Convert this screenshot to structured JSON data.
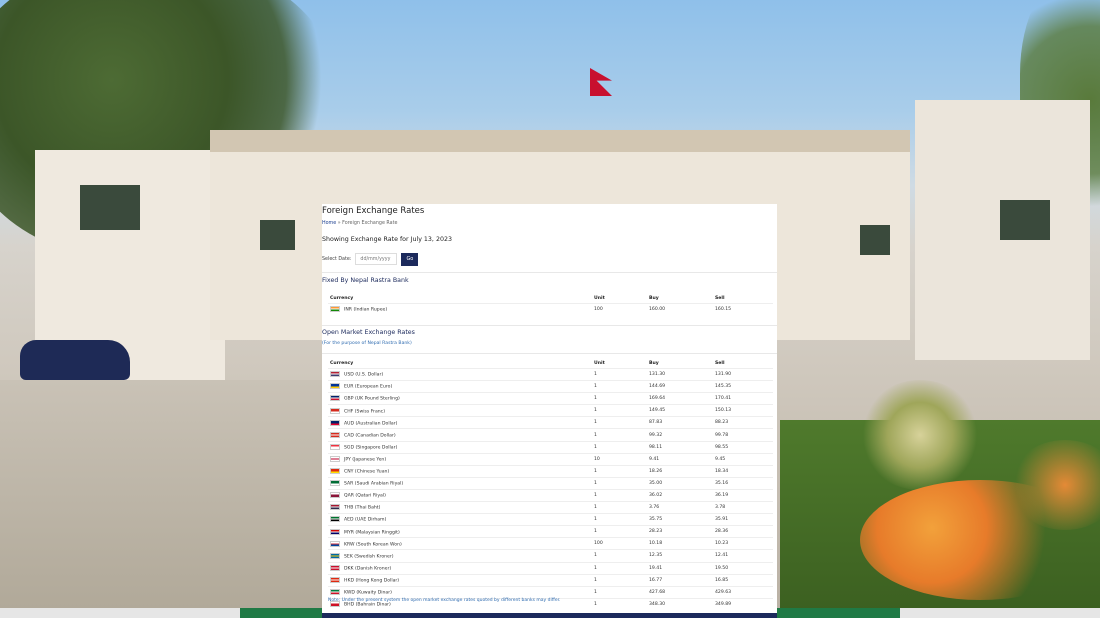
{
  "page": {
    "title": "Foreign Exchange Rates",
    "breadcrumb": {
      "home": "Home",
      "separator": "»",
      "current": "Foreign Exchange Rate"
    },
    "showing": "Showing Exchange Rate for July 13, 2023",
    "date_filter": {
      "label": "Select Date:",
      "placeholder": "dd/mm/yyyy",
      "button": "Go"
    }
  },
  "fixed": {
    "title": "Fixed By Nepal Rastra Bank",
    "headers": {
      "currency": "Currency",
      "unit": "Unit",
      "buy": "Buy",
      "sell": "Sell"
    },
    "rows": [
      {
        "currency": "INR (Indian Rupee)",
        "unit": "100",
        "buy": "160.00",
        "sell": "160.15",
        "flag": "in",
        "flag_colors": [
          "#ff9933",
          "#ffffff",
          "#138808"
        ]
      }
    ]
  },
  "open_market": {
    "title": "Open Market Exchange Rates",
    "subtitle": "(For the purpose of Nepal Rastra Bank)",
    "headers": {
      "currency": "Currency",
      "unit": "Unit",
      "buy": "Buy",
      "sell": "Sell"
    },
    "rows": [
      {
        "currency": "USD (U.S. Dollar)",
        "unit": "1",
        "buy": "131.30",
        "sell": "131.90",
        "flag": "us",
        "flag_colors": [
          "#b22234",
          "#ffffff",
          "#3c3b6e"
        ]
      },
      {
        "currency": "EUR (European Euro)",
        "unit": "1",
        "buy": "144.69",
        "sell": "145.35",
        "flag": "eu",
        "flag_colors": [
          "#003399",
          "#003399",
          "#ffcc00"
        ]
      },
      {
        "currency": "GBP (UK Pound Sterling)",
        "unit": "1",
        "buy": "169.64",
        "sell": "170.41",
        "flag": "gb",
        "flag_colors": [
          "#012169",
          "#ffffff",
          "#c8102e"
        ]
      },
      {
        "currency": "CHF (Swiss Franc)",
        "unit": "1",
        "buy": "149.45",
        "sell": "150.13",
        "flag": "ch",
        "flag_colors": [
          "#d52b1e",
          "#d52b1e",
          "#ffffff"
        ]
      },
      {
        "currency": "AUD (Australian Dollar)",
        "unit": "1",
        "buy": "87.83",
        "sell": "88.23",
        "flag": "au",
        "flag_colors": [
          "#012169",
          "#012169",
          "#e4002b"
        ]
      },
      {
        "currency": "CAD (Canadian Dollar)",
        "unit": "1",
        "buy": "99.32",
        "sell": "99.78",
        "flag": "ca",
        "flag_colors": [
          "#d52b1e",
          "#ffffff",
          "#d52b1e"
        ]
      },
      {
        "currency": "SGD (Singapore Dollar)",
        "unit": "1",
        "buy": "98.11",
        "sell": "98.55",
        "flag": "sg",
        "flag_colors": [
          "#ef3340",
          "#ffffff",
          "#ffffff"
        ]
      },
      {
        "currency": "JPY (Japanese Yen)",
        "unit": "10",
        "buy": "9.41",
        "sell": "9.45",
        "flag": "jp",
        "flag_colors": [
          "#ffffff",
          "#bc002d",
          "#ffffff"
        ]
      },
      {
        "currency": "CNY (Chinese Yuan)",
        "unit": "1",
        "buy": "18.26",
        "sell": "18.34",
        "flag": "cn",
        "flag_colors": [
          "#de2910",
          "#de2910",
          "#ffde00"
        ]
      },
      {
        "currency": "SAR (Saudi Arabian Riyal)",
        "unit": "1",
        "buy": "35.00",
        "sell": "35.16",
        "flag": "sa",
        "flag_colors": [
          "#006c35",
          "#006c35",
          "#ffffff"
        ]
      },
      {
        "currency": "QAR (Qatari Riyal)",
        "unit": "1",
        "buy": "36.02",
        "sell": "36.19",
        "flag": "qa",
        "flag_colors": [
          "#ffffff",
          "#8a1538",
          "#8a1538"
        ]
      },
      {
        "currency": "THB (Thai Baht)",
        "unit": "1",
        "buy": "3.76",
        "sell": "3.78",
        "flag": "th",
        "flag_colors": [
          "#a51931",
          "#f4f5f8",
          "#2d2a4a"
        ]
      },
      {
        "currency": "AED (UAE Dirham)",
        "unit": "1",
        "buy": "35.75",
        "sell": "35.91",
        "flag": "ae",
        "flag_colors": [
          "#00732f",
          "#ffffff",
          "#000000"
        ]
      },
      {
        "currency": "MYR (Malaysian Ringgit)",
        "unit": "1",
        "buy": "28.23",
        "sell": "28.36",
        "flag": "my",
        "flag_colors": [
          "#cc0001",
          "#ffffff",
          "#010066"
        ]
      },
      {
        "currency": "KRW (South Korean Won)",
        "unit": "100",
        "buy": "10.18",
        "sell": "10.23",
        "flag": "kr",
        "flag_colors": [
          "#ffffff",
          "#cd2e3a",
          "#0047a0"
        ]
      },
      {
        "currency": "SEK (Swedish Kroner)",
        "unit": "1",
        "buy": "12.35",
        "sell": "12.41",
        "flag": "se",
        "flag_colors": [
          "#006aa7",
          "#fecc00",
          "#006aa7"
        ]
      },
      {
        "currency": "DKK (Danish Kroner)",
        "unit": "1",
        "buy": "19.41",
        "sell": "19.50",
        "flag": "dk",
        "flag_colors": [
          "#c8102e",
          "#ffffff",
          "#c8102e"
        ]
      },
      {
        "currency": "HKD (Hong Kong Dollar)",
        "unit": "1",
        "buy": "16.77",
        "sell": "16.85",
        "flag": "hk",
        "flag_colors": [
          "#de2910",
          "#ffffff",
          "#de2910"
        ]
      },
      {
        "currency": "KWD (Kuwaity Dinar)",
        "unit": "1",
        "buy": "427.68",
        "sell": "429.63",
        "flag": "kw",
        "flag_colors": [
          "#007a3d",
          "#ffffff",
          "#ce1126"
        ]
      },
      {
        "currency": "BHD (Bahrain Dinar)",
        "unit": "1",
        "buy": "348.30",
        "sell": "349.89",
        "flag": "bh",
        "flag_colors": [
          "#ffffff",
          "#ce1126",
          "#ce1126"
        ]
      }
    ]
  },
  "note": "Note: Under the present system the open market exchange rates quoted by different banks may differ."
}
